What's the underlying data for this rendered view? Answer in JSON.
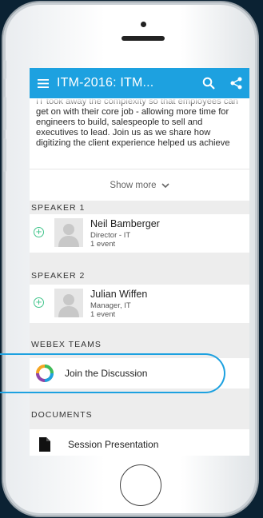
{
  "appbar": {
    "title": "ITM-2016: ITM...",
    "menu_icon": "hamburger-menu-icon",
    "search_icon": "search-icon",
    "share_icon": "share-icon",
    "color": "#1da1e0"
  },
  "description": {
    "text": "IT took away the complexity so that employees can get on with their core job - allowing more time for engineers to build, salespeople to sell and executives to lead. Join us as we share how digitizing the client experience helped us achieve",
    "show_more_label": "Show more"
  },
  "speakers": [
    {
      "section": "SPEAKER 1",
      "name": "Neil Bamberger",
      "role": "Director - IT",
      "events": "1 event"
    },
    {
      "section": "SPEAKER 2",
      "name": "Julian Wiffen",
      "role": "Manager, IT",
      "events": "1 event"
    }
  ],
  "webex": {
    "section": "WEBEX TEAMS",
    "join_label": "Join the Discussion",
    "highlight_color": "#1da1e0"
  },
  "documents": {
    "section": "DOCUMENTS",
    "item_label": "Session Presentation"
  }
}
